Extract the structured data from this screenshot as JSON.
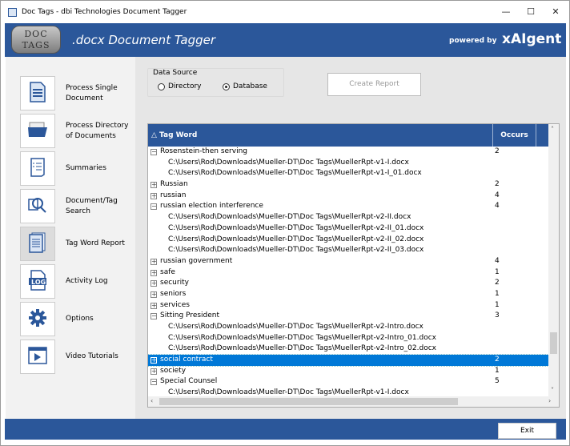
{
  "window": {
    "title": "Doc Tags - dbi Technologies Document Tagger",
    "minimize": "—",
    "maximize": "☐",
    "close": "✕"
  },
  "header": {
    "logo_line1": "DOC",
    "logo_line2": "TAGS",
    "title": ".docx Document Tagger",
    "powered_by": "powered by",
    "brand": "xAIgent",
    "color": "#2b579a"
  },
  "sidebar": {
    "items": [
      {
        "label": "Process Single Document",
        "icon": "document-icon"
      },
      {
        "label": "Process Directory of Documents",
        "icon": "folder-icon"
      },
      {
        "label": "Summaries",
        "icon": "checklist-icon"
      },
      {
        "label": "Document/Tag Search",
        "icon": "search-icon"
      },
      {
        "label": "Tag Word Report",
        "icon": "report-icon",
        "active": true
      },
      {
        "label": "Activity Log",
        "icon": "log-icon"
      },
      {
        "label": "Options",
        "icon": "gear-icon"
      },
      {
        "label": "Video Tutorials",
        "icon": "video-icon"
      }
    ]
  },
  "data_source": {
    "legend": "Data Source",
    "options": [
      {
        "label": "Directory",
        "selected": false
      },
      {
        "label": "Database",
        "selected": true
      }
    ]
  },
  "create_report": "Create Report",
  "grid": {
    "col_tag": "△ Tag Word",
    "col_occurs": "Occurs",
    "rows": [
      {
        "type": "tag",
        "expanded": true,
        "tag": "Rosenstein-then serving",
        "occurs": "2"
      },
      {
        "type": "path",
        "text": "C:\\Users\\Rod\\Downloads\\Mueller-DT\\Doc Tags\\MuellerRpt-v1-I.docx"
      },
      {
        "type": "path",
        "text": "C:\\Users\\Rod\\Downloads\\Mueller-DT\\Doc Tags\\MuellerRpt-v1-I_01.docx"
      },
      {
        "type": "tag",
        "expanded": false,
        "tag": "Russian",
        "occurs": "2"
      },
      {
        "type": "tag",
        "expanded": false,
        "tag": "russian",
        "occurs": "4"
      },
      {
        "type": "tag",
        "expanded": true,
        "tag": "russian election interference",
        "occurs": "4"
      },
      {
        "type": "path",
        "text": "C:\\Users\\Rod\\Downloads\\Mueller-DT\\Doc Tags\\MuellerRpt-v2-II.docx"
      },
      {
        "type": "path",
        "text": "C:\\Users\\Rod\\Downloads\\Mueller-DT\\Doc Tags\\MuellerRpt-v2-II_01.docx"
      },
      {
        "type": "path",
        "text": "C:\\Users\\Rod\\Downloads\\Mueller-DT\\Doc Tags\\MuellerRpt-v2-II_02.docx"
      },
      {
        "type": "path",
        "text": "C:\\Users\\Rod\\Downloads\\Mueller-DT\\Doc Tags\\MuellerRpt-v2-II_03.docx"
      },
      {
        "type": "tag",
        "expanded": false,
        "tag": "russian government",
        "occurs": "4"
      },
      {
        "type": "tag",
        "expanded": false,
        "tag": "safe",
        "occurs": "1"
      },
      {
        "type": "tag",
        "expanded": false,
        "tag": "security",
        "occurs": "2"
      },
      {
        "type": "tag",
        "expanded": false,
        "tag": "seniors",
        "occurs": "1"
      },
      {
        "type": "tag",
        "expanded": false,
        "tag": "services",
        "occurs": "1"
      },
      {
        "type": "tag",
        "expanded": true,
        "tag": "Sitting President",
        "occurs": "3"
      },
      {
        "type": "path",
        "text": "C:\\Users\\Rod\\Downloads\\Mueller-DT\\Doc Tags\\MuellerRpt-v2-Intro.docx"
      },
      {
        "type": "path",
        "text": "C:\\Users\\Rod\\Downloads\\Mueller-DT\\Doc Tags\\MuellerRpt-v2-Intro_01.docx"
      },
      {
        "type": "path",
        "text": "C:\\Users\\Rod\\Downloads\\Mueller-DT\\Doc Tags\\MuellerRpt-v2-Intro_02.docx"
      },
      {
        "type": "tag",
        "expanded": false,
        "tag": "social contract",
        "occurs": "2",
        "selected": true
      },
      {
        "type": "tag",
        "expanded": false,
        "tag": "society",
        "occurs": "1"
      },
      {
        "type": "tag",
        "expanded": true,
        "tag": "Special Counsel",
        "occurs": "5"
      },
      {
        "type": "path",
        "text": "C:\\Users\\Rod\\Downloads\\Mueller-DT\\Doc Tags\\MuellerRpt-v1-I.docx"
      }
    ]
  },
  "footer": {
    "exit": "Exit"
  }
}
